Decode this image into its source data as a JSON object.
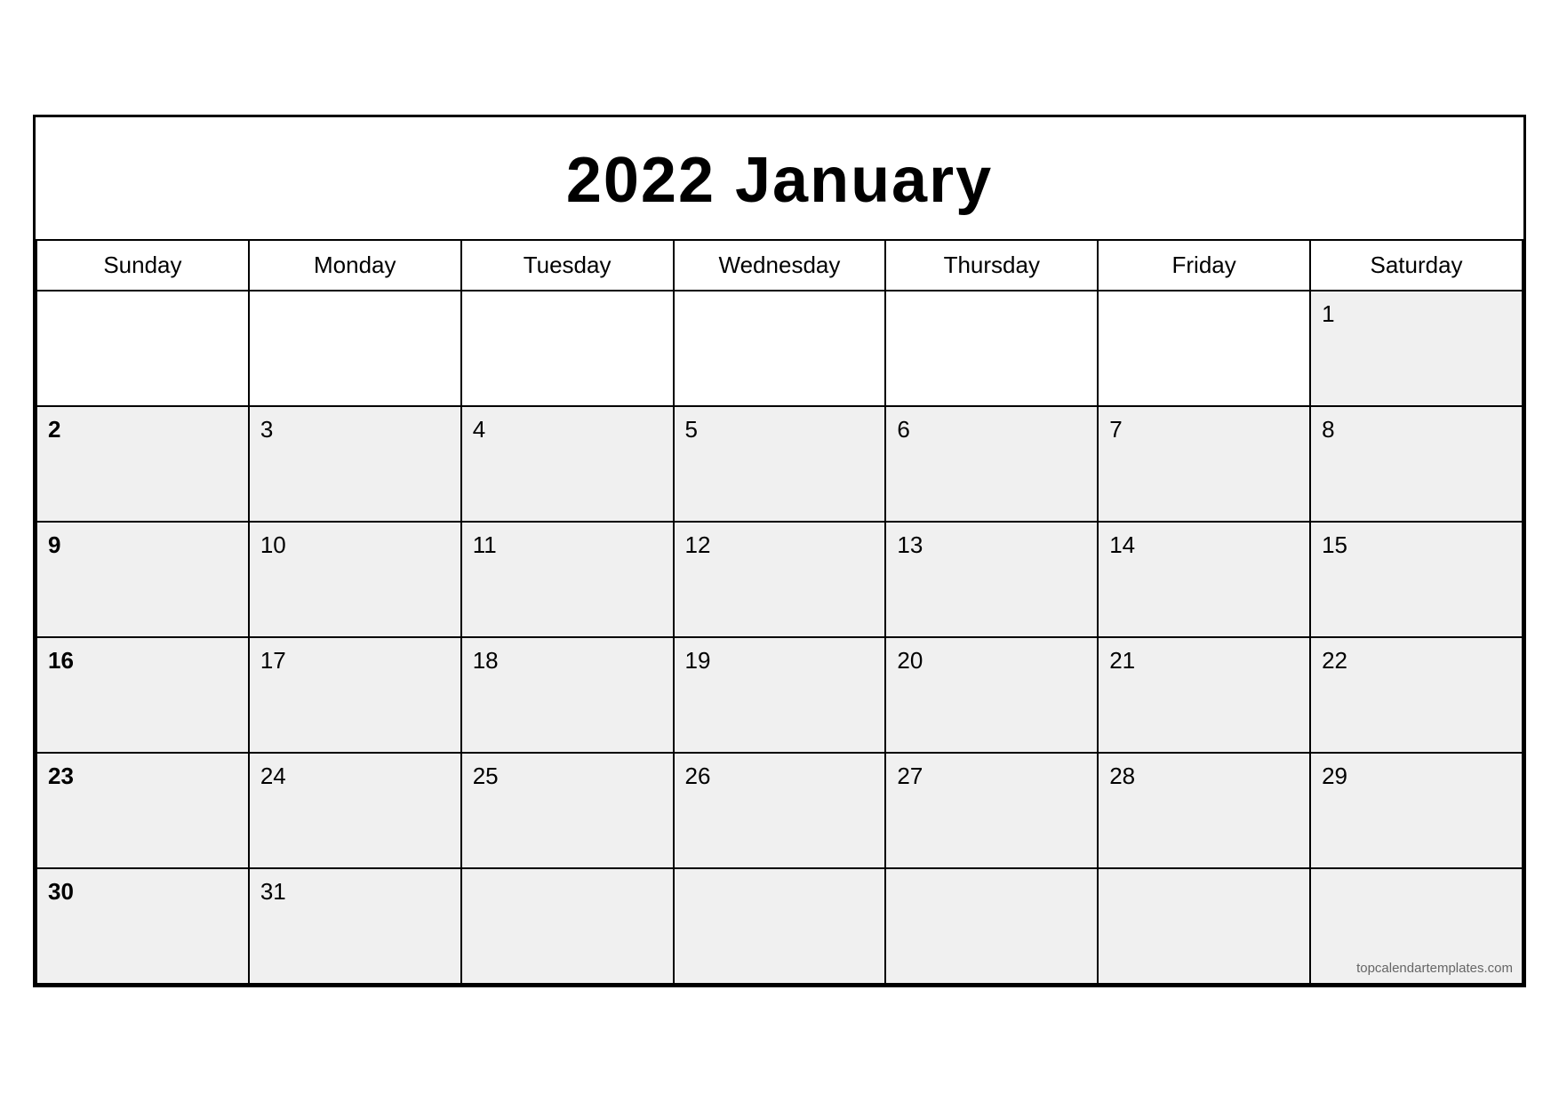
{
  "calendar": {
    "title": "2022 January",
    "days_of_week": [
      "Sunday",
      "Monday",
      "Tuesday",
      "Wednesday",
      "Thursday",
      "Friday",
      "Saturday"
    ],
    "weeks": [
      [
        {
          "day": "",
          "empty": true
        },
        {
          "day": "",
          "empty": true
        },
        {
          "day": "",
          "empty": true
        },
        {
          "day": "",
          "empty": true
        },
        {
          "day": "",
          "empty": true
        },
        {
          "day": "",
          "empty": true
        },
        {
          "day": "1",
          "bold": false
        }
      ],
      [
        {
          "day": "2",
          "bold": true
        },
        {
          "day": "3",
          "bold": false
        },
        {
          "day": "4",
          "bold": false
        },
        {
          "day": "5",
          "bold": false
        },
        {
          "day": "6",
          "bold": false
        },
        {
          "day": "7",
          "bold": false
        },
        {
          "day": "8",
          "bold": false
        }
      ],
      [
        {
          "day": "9",
          "bold": true
        },
        {
          "day": "10",
          "bold": false
        },
        {
          "day": "11",
          "bold": false
        },
        {
          "day": "12",
          "bold": false
        },
        {
          "day": "13",
          "bold": false
        },
        {
          "day": "14",
          "bold": false
        },
        {
          "day": "15",
          "bold": false
        }
      ],
      [
        {
          "day": "16",
          "bold": true
        },
        {
          "day": "17",
          "bold": false
        },
        {
          "day": "18",
          "bold": false
        },
        {
          "day": "19",
          "bold": false
        },
        {
          "day": "20",
          "bold": false
        },
        {
          "day": "21",
          "bold": false
        },
        {
          "day": "22",
          "bold": false
        }
      ],
      [
        {
          "day": "23",
          "bold": true
        },
        {
          "day": "24",
          "bold": false
        },
        {
          "day": "25",
          "bold": false
        },
        {
          "day": "26",
          "bold": false
        },
        {
          "day": "27",
          "bold": false
        },
        {
          "day": "28",
          "bold": false
        },
        {
          "day": "29",
          "bold": false
        }
      ],
      [
        {
          "day": "30",
          "bold": true
        },
        {
          "day": "31",
          "bold": false
        },
        {
          "day": "",
          "empty": false
        },
        {
          "day": "",
          "empty": false
        },
        {
          "day": "",
          "empty": false
        },
        {
          "day": "",
          "empty": false
        },
        {
          "day": "",
          "empty": false,
          "watermark": true
        }
      ]
    ],
    "watermark": "topcalendartemplates.com"
  }
}
